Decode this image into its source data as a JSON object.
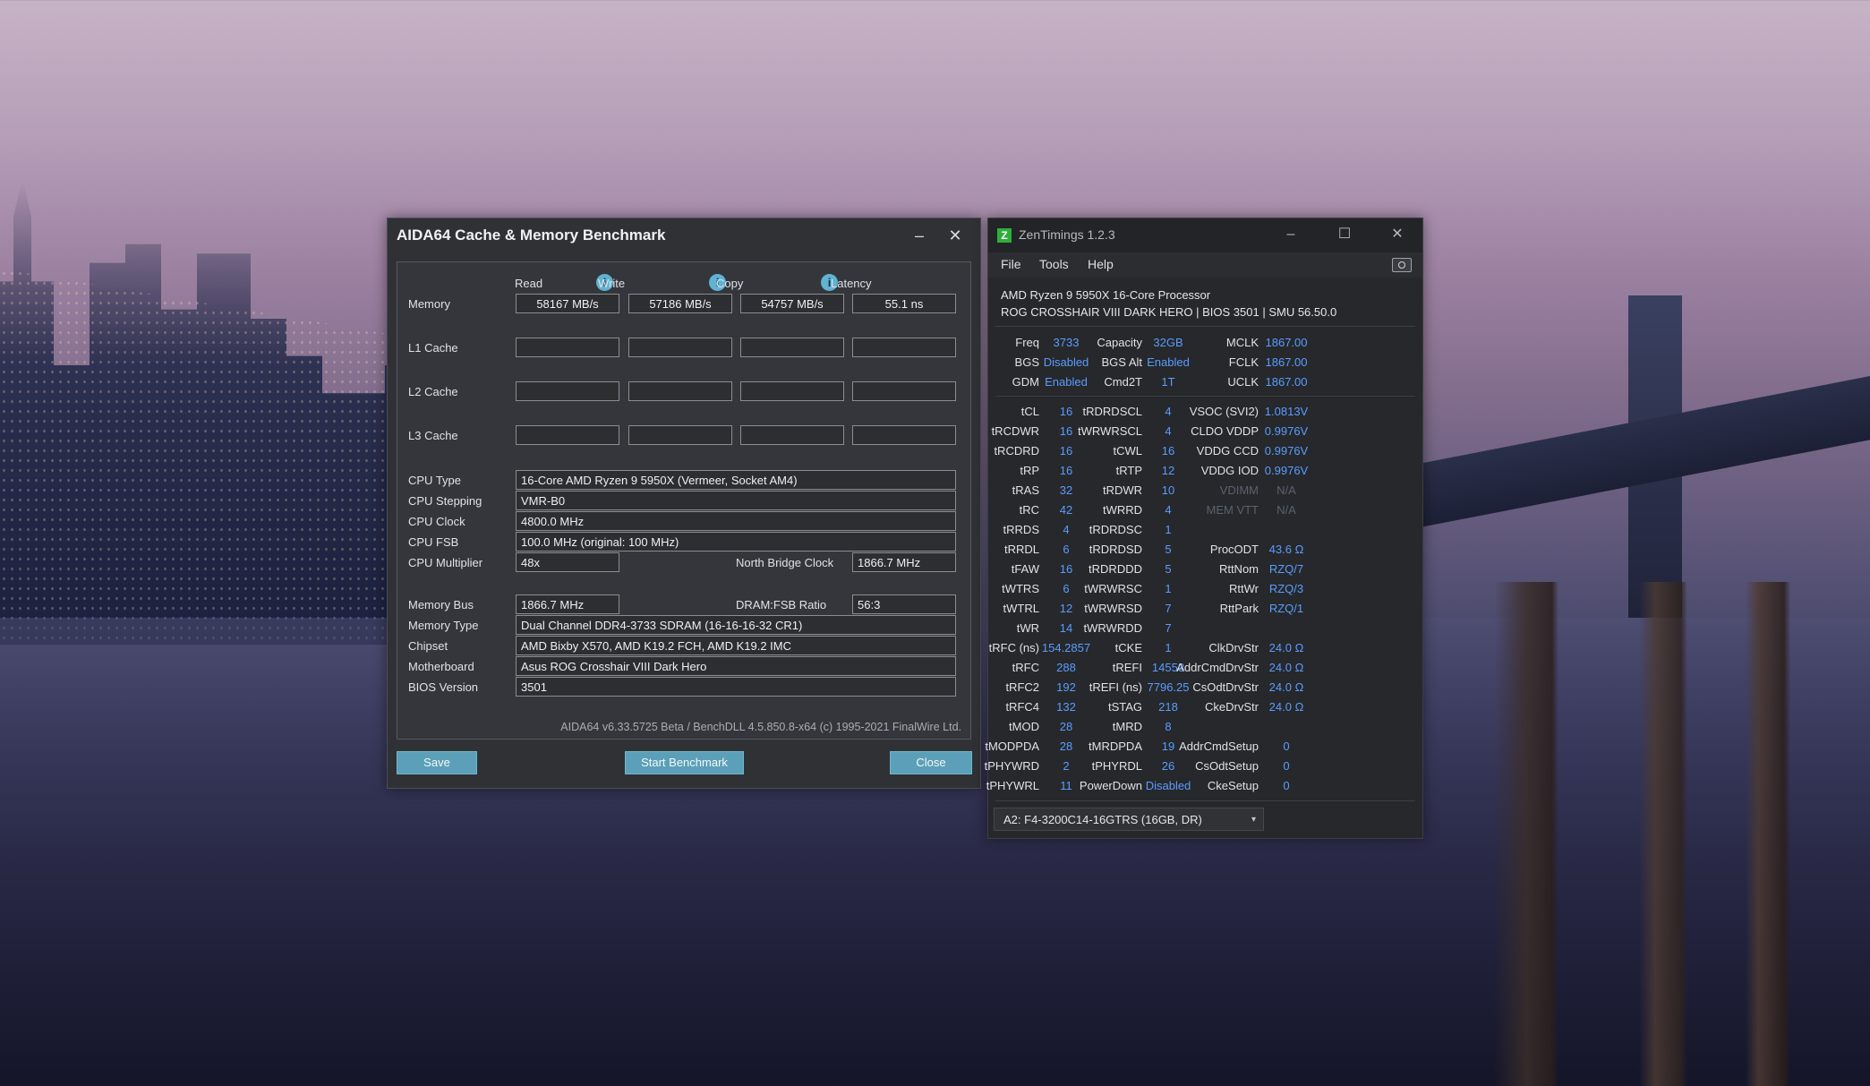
{
  "aida": {
    "title": "AIDA64 Cache & Memory Benchmark",
    "minimize_glyph": "–",
    "close_glyph": "✕",
    "columns": [
      "Read",
      "Write",
      "Copy",
      "Latency"
    ],
    "info_glyph": "i",
    "rows": [
      {
        "label": "Memory",
        "values": [
          "58167 MB/s",
          "57186 MB/s",
          "54757 MB/s",
          "55.1 ns"
        ]
      },
      {
        "label": "L1 Cache",
        "values": [
          "",
          "",
          "",
          ""
        ]
      },
      {
        "label": "L2 Cache",
        "values": [
          "",
          "",
          "",
          ""
        ]
      },
      {
        "label": "L3 Cache",
        "values": [
          "",
          "",
          "",
          ""
        ]
      }
    ],
    "cpu_type_label": "CPU Type",
    "cpu_type": "16-Core AMD Ryzen 9 5950X  (Vermeer, Socket AM4)",
    "cpu_stepping_label": "CPU Stepping",
    "cpu_stepping": "VMR-B0",
    "cpu_clock_label": "CPU Clock",
    "cpu_clock": "4800.0 MHz",
    "cpu_fsb_label": "CPU FSB",
    "cpu_fsb": "100.0 MHz  (original: 100 MHz)",
    "cpu_multiplier_label": "CPU Multiplier",
    "cpu_multiplier": "48x",
    "nb_clock_label": "North Bridge Clock",
    "nb_clock": "1866.7 MHz",
    "memory_bus_label": "Memory Bus",
    "memory_bus": "1866.7 MHz",
    "dram_fsb_label": "DRAM:FSB Ratio",
    "dram_fsb": "56:3",
    "memory_type_label": "Memory Type",
    "memory_type": "Dual Channel DDR4-3733 SDRAM  (16-16-16-32 CR1)",
    "chipset_label": "Chipset",
    "chipset": "AMD Bixby X570, AMD K19.2 FCH, AMD K19.2 IMC",
    "motherboard_label": "Motherboard",
    "motherboard": "Asus ROG Crosshair VIII Dark Hero",
    "bios_label": "BIOS Version",
    "bios": "3501",
    "footer": "AIDA64 v6.33.5725 Beta / BenchDLL 4.5.850.8-x64  (c) 1995-2021 FinalWire Ltd.",
    "save_label": "Save",
    "start_label": "Start Benchmark",
    "close_label": "Close"
  },
  "zen": {
    "title": "ZenTimings 1.2.3",
    "logo_glyph": "Z",
    "minimize_glyph": "–",
    "maximize_glyph": "☐",
    "close_glyph": "✕",
    "menu": [
      "File",
      "Tools",
      "Help"
    ],
    "processor": "AMD Ryzen 9 5950X 16-Core Processor",
    "board": "ROG CROSSHAIR VIII DARK HERO | BIOS 3501 | SMU 56.50.0",
    "top_rows": [
      [
        "Freq",
        "3733",
        "Capacity",
        "32GB",
        "MCLK",
        "1867.00"
      ],
      [
        "BGS",
        "Disabled",
        "BGS Alt",
        "Enabled",
        "FCLK",
        "1867.00"
      ],
      [
        "GDM",
        "Enabled",
        "Cmd2T",
        "1T",
        "UCLK",
        "1867.00"
      ]
    ],
    "timing_rows": [
      [
        "tCL",
        "16",
        "tRDRDSCL",
        "4",
        "VSOC (SVI2)",
        "1.0813V"
      ],
      [
        "tRCDWR",
        "16",
        "tWRWRSCL",
        "4",
        "CLDO VDDP",
        "0.9976V"
      ],
      [
        "tRCDRD",
        "16",
        "tCWL",
        "16",
        "VDDG CCD",
        "0.9976V"
      ],
      [
        "tRP",
        "16",
        "tRTP",
        "12",
        "VDDG IOD",
        "0.9976V"
      ],
      [
        "tRAS",
        "32",
        "tRDWR",
        "10",
        "VDIMM",
        "N/A"
      ],
      [
        "tRC",
        "42",
        "tWRRD",
        "4",
        "MEM VTT",
        "N/A"
      ],
      [
        "tRRDS",
        "4",
        "tRDRDSC",
        "1",
        "",
        ""
      ],
      [
        "tRRDL",
        "6",
        "tRDRDSD",
        "5",
        "ProcODT",
        "43.6 Ω"
      ],
      [
        "tFAW",
        "16",
        "tRDRDDD",
        "5",
        "RttNom",
        "RZQ/7"
      ],
      [
        "tWTRS",
        "6",
        "tWRWRSC",
        "1",
        "RttWr",
        "RZQ/3"
      ],
      [
        "tWTRL",
        "12",
        "tWRWRSD",
        "7",
        "RttPark",
        "RZQ/1"
      ],
      [
        "tWR",
        "14",
        "tWRWRDD",
        "7",
        "",
        ""
      ],
      [
        "tRFC (ns)",
        "154.2857",
        "tCKE",
        "1",
        "ClkDrvStr",
        "24.0 Ω"
      ],
      [
        "tRFC",
        "288",
        "tREFI",
        "14553",
        "AddrCmdDrvStr",
        "24.0 Ω"
      ],
      [
        "tRFC2",
        "192",
        "tREFI (ns)",
        "7796.25",
        "CsOdtDrvStr",
        "24.0 Ω"
      ],
      [
        "tRFC4",
        "132",
        "tSTAG",
        "218",
        "CkeDrvStr",
        "24.0 Ω"
      ],
      [
        "tMOD",
        "28",
        "tMRD",
        "8",
        "",
        ""
      ],
      [
        "tMODPDA",
        "28",
        "tMRDPDA",
        "19",
        "AddrCmdSetup",
        "0"
      ],
      [
        "tPHYWRD",
        "2",
        "tPHYRDL",
        "26",
        "CsOdtSetup",
        "0"
      ],
      [
        "tPHYWRL",
        "11",
        "PowerDown",
        "Disabled",
        "CkeSetup",
        "0"
      ]
    ],
    "dimm_select": "A2: F4-3200C14-16GTRS (16GB, DR)",
    "dropdown_glyph": "▾",
    "value_color": "#5b9cff"
  }
}
